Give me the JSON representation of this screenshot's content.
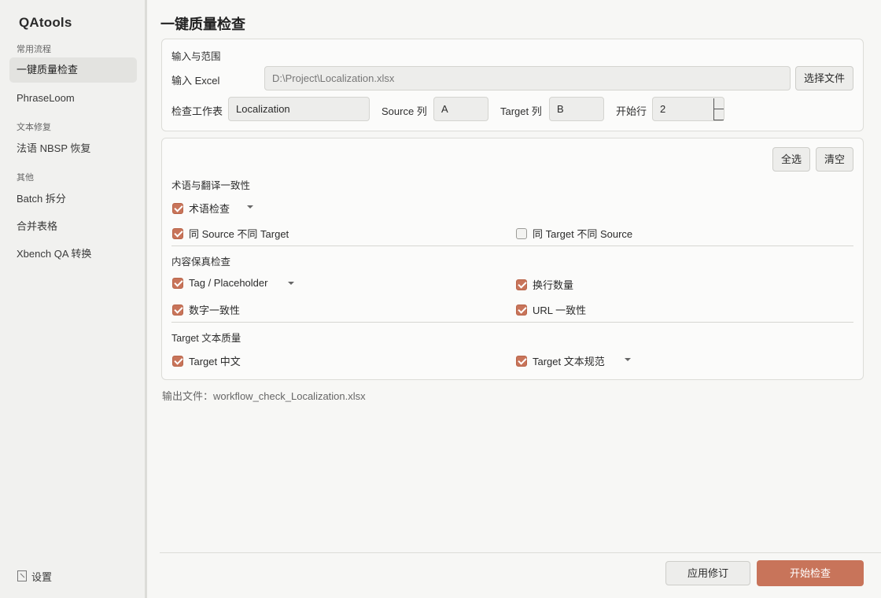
{
  "app": {
    "title": "QAtools"
  },
  "sidebar": {
    "sections": [
      {
        "label": "常用流程"
      },
      {
        "label": "文本修复"
      },
      {
        "label": "其他"
      }
    ],
    "items": [
      {
        "label": "一键质量检查",
        "active": true
      },
      {
        "label": "PhraseLoom"
      },
      {
        "label": "法语 NBSP 恢复"
      },
      {
        "label": "Batch 拆分"
      },
      {
        "label": "合并表格"
      },
      {
        "label": "Xbench QA 转换"
      }
    ],
    "settings": {
      "label": "设置",
      "icon": "settings-icon"
    }
  },
  "main": {
    "title": "一键质量检查",
    "input_panel": {
      "title": "输入与范围",
      "excel_label": "输入 Excel",
      "excel_path": "D:\\Project\\Localization.xlsx",
      "choose_file": "选择文件",
      "sheet_label": "检查工作表",
      "sheet_value": "Localization",
      "source_label": "Source 列",
      "source_value": "A",
      "target_label": "Target 列",
      "target_value": "B",
      "start_row_label": "开始行",
      "start_row_value": "2"
    },
    "checks_panel": {
      "select_all": "全选",
      "clear": "清空",
      "groups": [
        {
          "title": "术语与翻译一致性",
          "items": [
            {
              "label": "术语检查",
              "checked": true,
              "has_dropdown": true
            },
            {
              "label": "同 Source 不同 Target",
              "checked": true
            },
            {
              "label": "同 Target 不同 Source",
              "checked": false
            }
          ]
        },
        {
          "title": "内容保真检查",
          "items": [
            {
              "label": "Tag / Placeholder",
              "checked": true,
              "has_dropdown": true
            },
            {
              "label": "换行数量",
              "checked": true
            },
            {
              "label": "数字一致性",
              "checked": true
            },
            {
              "label": "URL 一致性",
              "checked": true
            }
          ]
        },
        {
          "title": "Target 文本质量",
          "items": [
            {
              "label": "Target 中文",
              "checked": true
            },
            {
              "label": "Target 文本规范",
              "checked": true,
              "has_dropdown": true
            }
          ]
        }
      ]
    },
    "output": "输出文件：workflow_check_Localization.xlsx"
  },
  "footer": {
    "apply_label": "应用修订",
    "start_label": "开始检查"
  },
  "colors": {
    "accent": "#c8745a",
    "sidebar_bg": "#f1f1ef",
    "page_bg": "#f7f7f5"
  }
}
